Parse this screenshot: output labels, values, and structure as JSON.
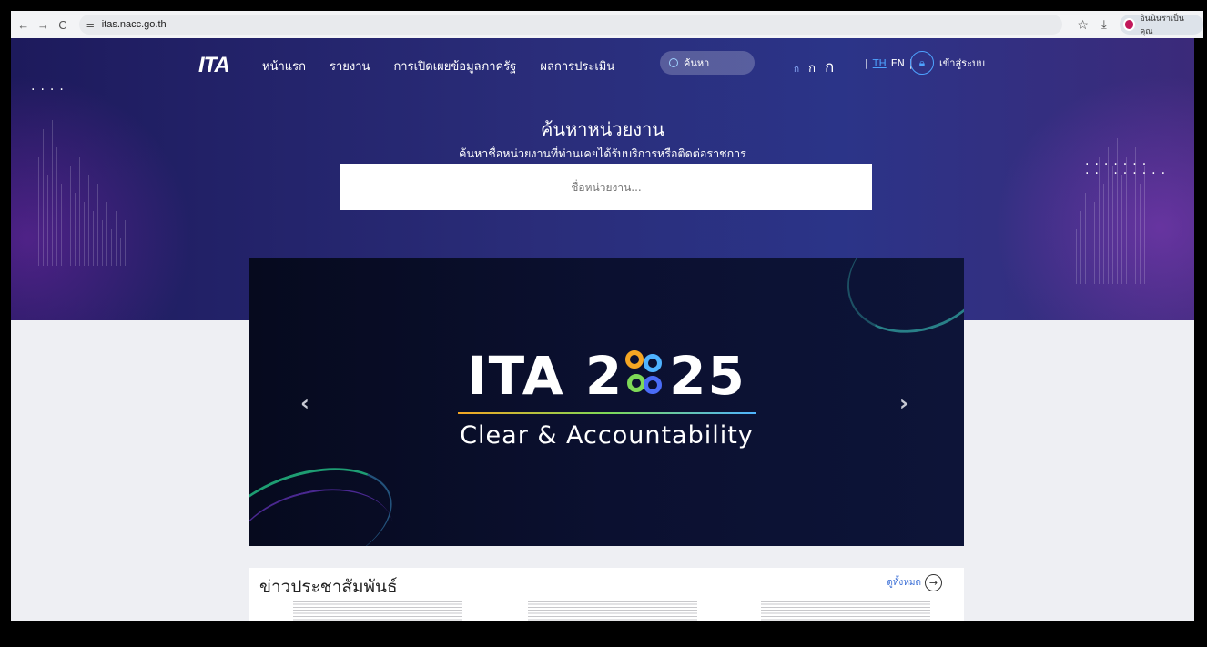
{
  "browser": {
    "back_label": "←",
    "forward_label": "→",
    "reload_label": "C",
    "url": "itas.nacc.go.th",
    "profile_label": "อินนินร่าเป็นคุณ"
  },
  "nav": {
    "logo_text": "ITA",
    "menu": [
      "หน้าแรก",
      "รายงาน",
      "การเปิดเผยข้อมูลภาครัฐ",
      "ผลการประเมิน"
    ],
    "search_label": "ค้นหา",
    "font_sizes": [
      "ก",
      "ก",
      "ก"
    ],
    "lang_th": "TH",
    "lang_en": "EN",
    "separator": "|",
    "login_label": "เข้าสู่ระบบ"
  },
  "hero": {
    "title": "ค้นหาหน่วยงาน",
    "subtitle": "ค้นหาชื่อหน่วยงานที่ท่านเคยได้รับบริการหรือติดต่อราชการ",
    "search_placeholder": "ชื่อหน่วยงาน..."
  },
  "banner": {
    "title_left": "ITA 2",
    "title_right": "25",
    "subtitle": "Clear & Accountability",
    "prev_label": "‹",
    "next_label": "›"
  },
  "news": {
    "title": "ข่าวประชาสัมพันธ์",
    "see_all": "ดูทั้งหมด",
    "see_all_icon": "→"
  },
  "colors": {
    "accent": "#4ea3ff",
    "hero_bg": "#2a2d7a",
    "banner_bg": "#0b1030"
  }
}
